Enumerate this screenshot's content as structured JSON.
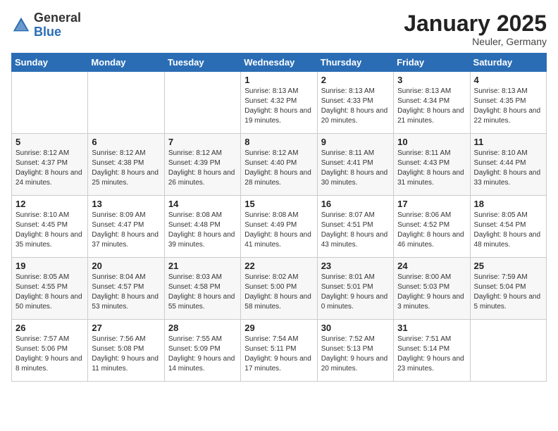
{
  "header": {
    "logo_general": "General",
    "logo_blue": "Blue",
    "month_title": "January 2025",
    "location": "Neuler, Germany"
  },
  "weekdays": [
    "Sunday",
    "Monday",
    "Tuesday",
    "Wednesday",
    "Thursday",
    "Friday",
    "Saturday"
  ],
  "weeks": [
    [
      {
        "day": "",
        "sunrise": "",
        "sunset": "",
        "daylight": ""
      },
      {
        "day": "",
        "sunrise": "",
        "sunset": "",
        "daylight": ""
      },
      {
        "day": "",
        "sunrise": "",
        "sunset": "",
        "daylight": ""
      },
      {
        "day": "1",
        "sunrise": "Sunrise: 8:13 AM",
        "sunset": "Sunset: 4:32 PM",
        "daylight": "Daylight: 8 hours and 19 minutes."
      },
      {
        "day": "2",
        "sunrise": "Sunrise: 8:13 AM",
        "sunset": "Sunset: 4:33 PM",
        "daylight": "Daylight: 8 hours and 20 minutes."
      },
      {
        "day": "3",
        "sunrise": "Sunrise: 8:13 AM",
        "sunset": "Sunset: 4:34 PM",
        "daylight": "Daylight: 8 hours and 21 minutes."
      },
      {
        "day": "4",
        "sunrise": "Sunrise: 8:13 AM",
        "sunset": "Sunset: 4:35 PM",
        "daylight": "Daylight: 8 hours and 22 minutes."
      }
    ],
    [
      {
        "day": "5",
        "sunrise": "Sunrise: 8:12 AM",
        "sunset": "Sunset: 4:37 PM",
        "daylight": "Daylight: 8 hours and 24 minutes."
      },
      {
        "day": "6",
        "sunrise": "Sunrise: 8:12 AM",
        "sunset": "Sunset: 4:38 PM",
        "daylight": "Daylight: 8 hours and 25 minutes."
      },
      {
        "day": "7",
        "sunrise": "Sunrise: 8:12 AM",
        "sunset": "Sunset: 4:39 PM",
        "daylight": "Daylight: 8 hours and 26 minutes."
      },
      {
        "day": "8",
        "sunrise": "Sunrise: 8:12 AM",
        "sunset": "Sunset: 4:40 PM",
        "daylight": "Daylight: 8 hours and 28 minutes."
      },
      {
        "day": "9",
        "sunrise": "Sunrise: 8:11 AM",
        "sunset": "Sunset: 4:41 PM",
        "daylight": "Daylight: 8 hours and 30 minutes."
      },
      {
        "day": "10",
        "sunrise": "Sunrise: 8:11 AM",
        "sunset": "Sunset: 4:43 PM",
        "daylight": "Daylight: 8 hours and 31 minutes."
      },
      {
        "day": "11",
        "sunrise": "Sunrise: 8:10 AM",
        "sunset": "Sunset: 4:44 PM",
        "daylight": "Daylight: 8 hours and 33 minutes."
      }
    ],
    [
      {
        "day": "12",
        "sunrise": "Sunrise: 8:10 AM",
        "sunset": "Sunset: 4:45 PM",
        "daylight": "Daylight: 8 hours and 35 minutes."
      },
      {
        "day": "13",
        "sunrise": "Sunrise: 8:09 AM",
        "sunset": "Sunset: 4:47 PM",
        "daylight": "Daylight: 8 hours and 37 minutes."
      },
      {
        "day": "14",
        "sunrise": "Sunrise: 8:08 AM",
        "sunset": "Sunset: 4:48 PM",
        "daylight": "Daylight: 8 hours and 39 minutes."
      },
      {
        "day": "15",
        "sunrise": "Sunrise: 8:08 AM",
        "sunset": "Sunset: 4:49 PM",
        "daylight": "Daylight: 8 hours and 41 minutes."
      },
      {
        "day": "16",
        "sunrise": "Sunrise: 8:07 AM",
        "sunset": "Sunset: 4:51 PM",
        "daylight": "Daylight: 8 hours and 43 minutes."
      },
      {
        "day": "17",
        "sunrise": "Sunrise: 8:06 AM",
        "sunset": "Sunset: 4:52 PM",
        "daylight": "Daylight: 8 hours and 46 minutes."
      },
      {
        "day": "18",
        "sunrise": "Sunrise: 8:05 AM",
        "sunset": "Sunset: 4:54 PM",
        "daylight": "Daylight: 8 hours and 48 minutes."
      }
    ],
    [
      {
        "day": "19",
        "sunrise": "Sunrise: 8:05 AM",
        "sunset": "Sunset: 4:55 PM",
        "daylight": "Daylight: 8 hours and 50 minutes."
      },
      {
        "day": "20",
        "sunrise": "Sunrise: 8:04 AM",
        "sunset": "Sunset: 4:57 PM",
        "daylight": "Daylight: 8 hours and 53 minutes."
      },
      {
        "day": "21",
        "sunrise": "Sunrise: 8:03 AM",
        "sunset": "Sunset: 4:58 PM",
        "daylight": "Daylight: 8 hours and 55 minutes."
      },
      {
        "day": "22",
        "sunrise": "Sunrise: 8:02 AM",
        "sunset": "Sunset: 5:00 PM",
        "daylight": "Daylight: 8 hours and 58 minutes."
      },
      {
        "day": "23",
        "sunrise": "Sunrise: 8:01 AM",
        "sunset": "Sunset: 5:01 PM",
        "daylight": "Daylight: 9 hours and 0 minutes."
      },
      {
        "day": "24",
        "sunrise": "Sunrise: 8:00 AM",
        "sunset": "Sunset: 5:03 PM",
        "daylight": "Daylight: 9 hours and 3 minutes."
      },
      {
        "day": "25",
        "sunrise": "Sunrise: 7:59 AM",
        "sunset": "Sunset: 5:04 PM",
        "daylight": "Daylight: 9 hours and 5 minutes."
      }
    ],
    [
      {
        "day": "26",
        "sunrise": "Sunrise: 7:57 AM",
        "sunset": "Sunset: 5:06 PM",
        "daylight": "Daylight: 9 hours and 8 minutes."
      },
      {
        "day": "27",
        "sunrise": "Sunrise: 7:56 AM",
        "sunset": "Sunset: 5:08 PM",
        "daylight": "Daylight: 9 hours and 11 minutes."
      },
      {
        "day": "28",
        "sunrise": "Sunrise: 7:55 AM",
        "sunset": "Sunset: 5:09 PM",
        "daylight": "Daylight: 9 hours and 14 minutes."
      },
      {
        "day": "29",
        "sunrise": "Sunrise: 7:54 AM",
        "sunset": "Sunset: 5:11 PM",
        "daylight": "Daylight: 9 hours and 17 minutes."
      },
      {
        "day": "30",
        "sunrise": "Sunrise: 7:52 AM",
        "sunset": "Sunset: 5:13 PM",
        "daylight": "Daylight: 9 hours and 20 minutes."
      },
      {
        "day": "31",
        "sunrise": "Sunrise: 7:51 AM",
        "sunset": "Sunset: 5:14 PM",
        "daylight": "Daylight: 9 hours and 23 minutes."
      },
      {
        "day": "",
        "sunrise": "",
        "sunset": "",
        "daylight": ""
      }
    ]
  ]
}
